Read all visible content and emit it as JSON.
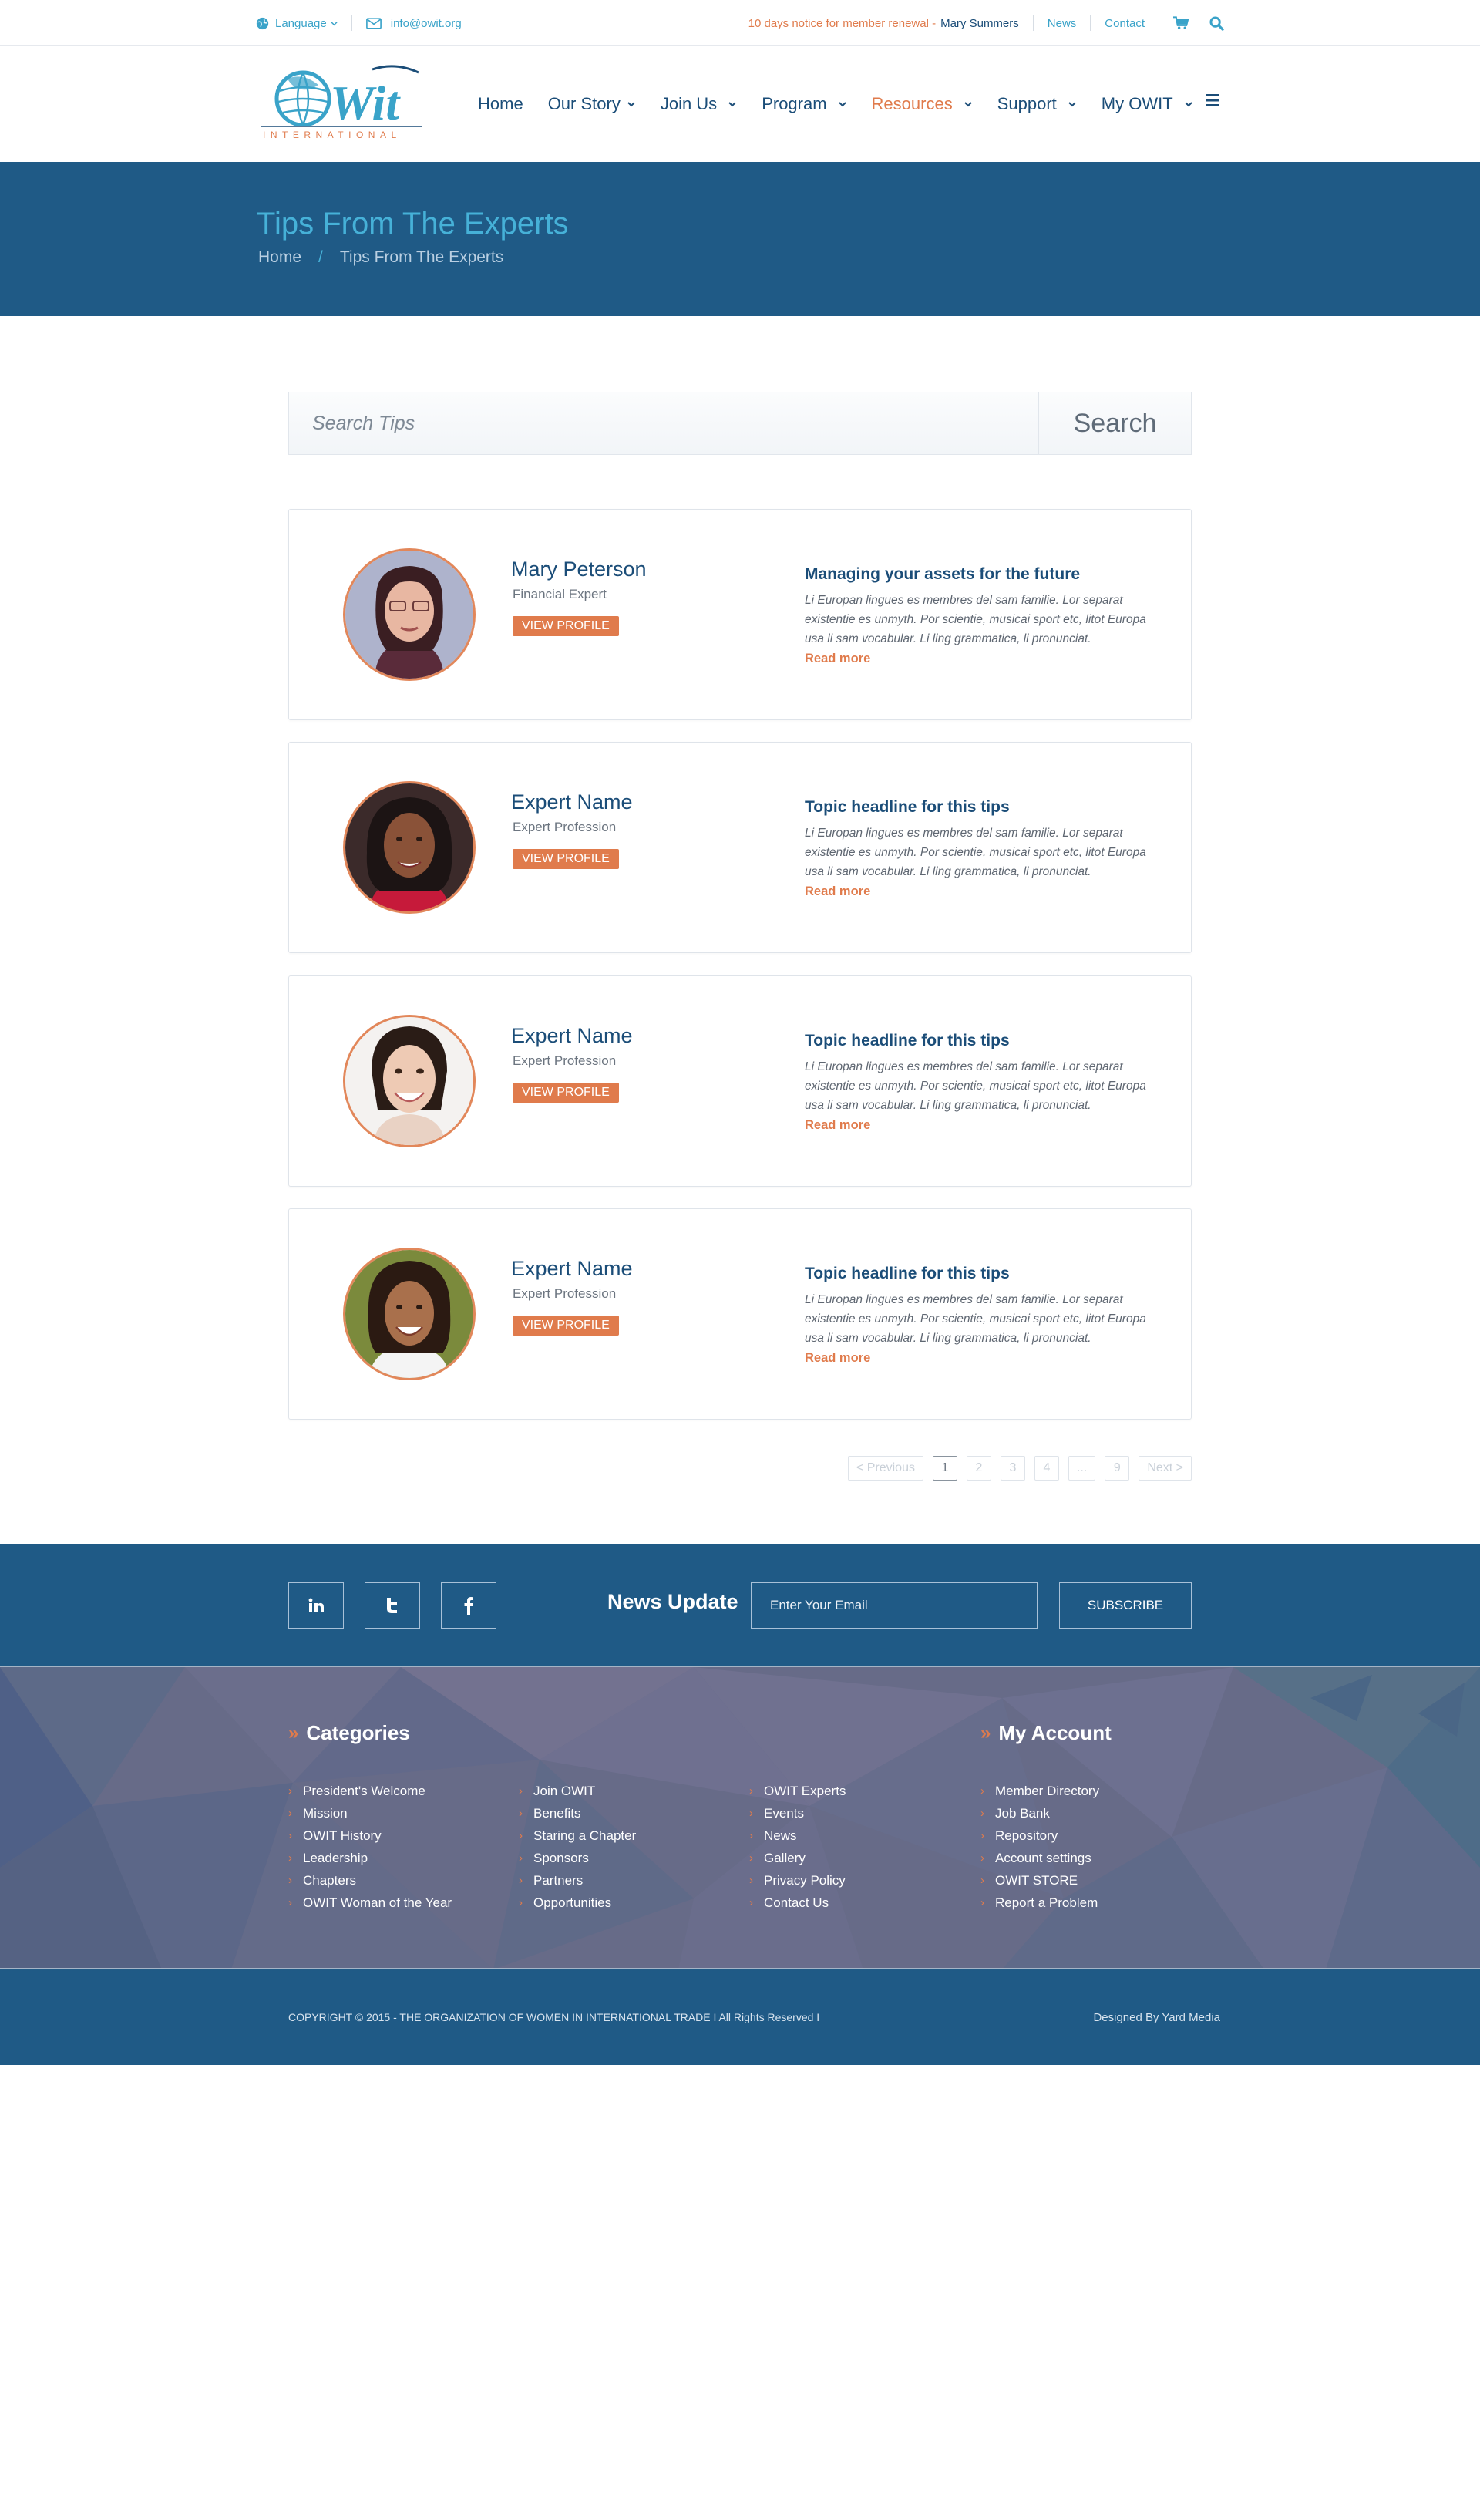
{
  "topbar": {
    "language": "Language",
    "email": "info@owit.org",
    "notice": "10 days notice for member renewal - ",
    "user": "Mary Summers",
    "news": "News",
    "contact": "Contact"
  },
  "logo": {
    "main": "OWIT",
    "sub": "INTERNATIONAL"
  },
  "nav": {
    "items": [
      {
        "label": "Home"
      },
      {
        "label": "Our Story"
      },
      {
        "label": "Join Us"
      },
      {
        "label": "Program"
      },
      {
        "label": "Resources"
      },
      {
        "label": "Support"
      },
      {
        "label": "My OWIT"
      }
    ]
  },
  "page": {
    "title": "Tips From The Experts",
    "breadcrumb_home": "Home",
    "breadcrumb_sep": "/",
    "breadcrumb_current": "Tips From The Experts"
  },
  "search": {
    "placeholder": "Search Tips",
    "button": "Search"
  },
  "experts": [
    {
      "name": "Mary Peterson",
      "profession": "Financial Expert",
      "button": "VIEW PROFILE",
      "tip_title": "Managing your assets for the future",
      "tip_text": "Li Europan lingues es membres del sam familie. Lor separat existentie es unmyth. Por scientie, musicai sport etc, litot Europa usa li sam vocabular. Li ling grammatica, li pronunciat.",
      "read_more": "Read more"
    },
    {
      "name": "Expert Name",
      "profession": "Expert Profession",
      "button": "VIEW PROFILE",
      "tip_title": "Topic headline for this tips",
      "tip_text": "Li Europan lingues es membres del sam familie. Lor separat existentie es unmyth. Por scientie, musicai sport etc, litot Europa usa li sam vocabular. Li ling grammatica, li pronunciat.",
      "read_more": "Read more"
    },
    {
      "name": "Expert Name",
      "profession": "Expert Profession",
      "button": "VIEW PROFILE",
      "tip_title": "Topic headline for this tips",
      "tip_text": "Li Europan lingues es membres del sam familie. Lor separat existentie es unmyth. Por scientie, musicai sport etc, litot Europa usa li sam vocabular. Li ling grammatica, li pronunciat.",
      "read_more": "Read more"
    },
    {
      "name": "Expert Name",
      "profession": "Expert Profession",
      "button": "VIEW PROFILE",
      "tip_title": "Topic headline for this tips",
      "tip_text": "Li Europan lingues es membres del sam familie. Lor separat existentie es unmyth. Por scientie, musicai sport etc, litot Europa usa li sam vocabular. Li ling grammatica, li pronunciat.",
      "read_more": "Read more"
    }
  ],
  "pagination": {
    "previous": "< Previous",
    "pages": [
      "1",
      "2",
      "3",
      "4",
      "...",
      "9"
    ],
    "next": "Next >"
  },
  "newsletter": {
    "label": "News Update",
    "placeholder": "Enter Your Email",
    "button": "SUBSCRIBE"
  },
  "footer": {
    "categories_title": "Categories",
    "account_title": "My Account",
    "col1": [
      "President's Welcome",
      "Mission",
      "OWIT History",
      "Leadership",
      "Chapters",
      "OWIT Woman of the Year"
    ],
    "col2": [
      "Join OWIT",
      "Benefits",
      "Staring a Chapter",
      "Sponsors",
      "Partners",
      "Opportunities"
    ],
    "col3": [
      "OWIT Experts",
      "Events",
      "News",
      "Gallery",
      "Privacy Policy",
      "Contact Us"
    ],
    "col4": [
      "Member Directory",
      "Job Bank",
      "Repository",
      "Account settings",
      "OWIT STORE",
      "Report a Problem"
    ],
    "copyright": "COPYRIGHT © 2015 - THE ORGANIZATION OF WOMEN IN INTERNATIONAL TRADE  I  All Rights Reserved  I",
    "designed_by": "Designed By Yard Media"
  },
  "colors": {
    "brand_blue": "#1f5a86",
    "accent_orange": "#e07b4c",
    "light_blue": "#46b1d8"
  }
}
